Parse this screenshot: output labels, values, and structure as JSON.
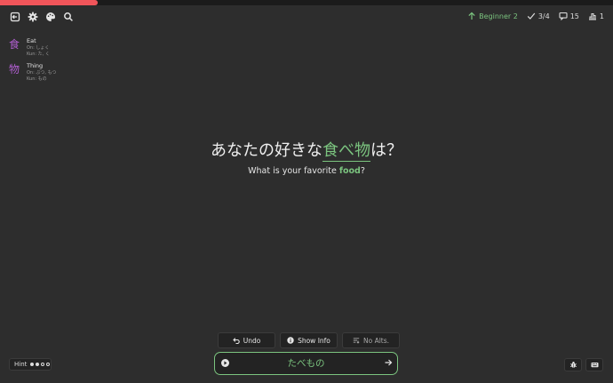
{
  "progress": {
    "fraction": 0.16,
    "color": "#f0555a"
  },
  "toolbar": {
    "icons": [
      "exit-icon",
      "gear-icon",
      "palette-icon",
      "search-icon"
    ]
  },
  "stats": {
    "level": "Beginner 2",
    "done": "3/4",
    "reviews": "15",
    "rank": "1"
  },
  "kanji": [
    {
      "char": "食",
      "meaning": "Eat",
      "on": "On:  しょく",
      "kun": "Kun:  た, く"
    },
    {
      "char": "物",
      "meaning": "Thing",
      "on": "On:  ぶつ, もつ",
      "kun": "Kun:  もの"
    }
  ],
  "sentence": {
    "before": "あなたの好きな",
    "target": "食べ物",
    "after": "は？"
  },
  "translation": {
    "before": "What is your favorite ",
    "highlight": "food",
    "after": "?"
  },
  "actions": {
    "undo": "Undo",
    "show_info": "Show Info",
    "no_alts": "No Alts."
  },
  "hint": {
    "label": "Hint",
    "dots_filled": 2,
    "dots_total": 4
  },
  "answer": {
    "value": "たべもの"
  },
  "colors": {
    "accent": "#7bc47f",
    "kanji": "#b05ed0",
    "background": "#2d2d2d"
  }
}
